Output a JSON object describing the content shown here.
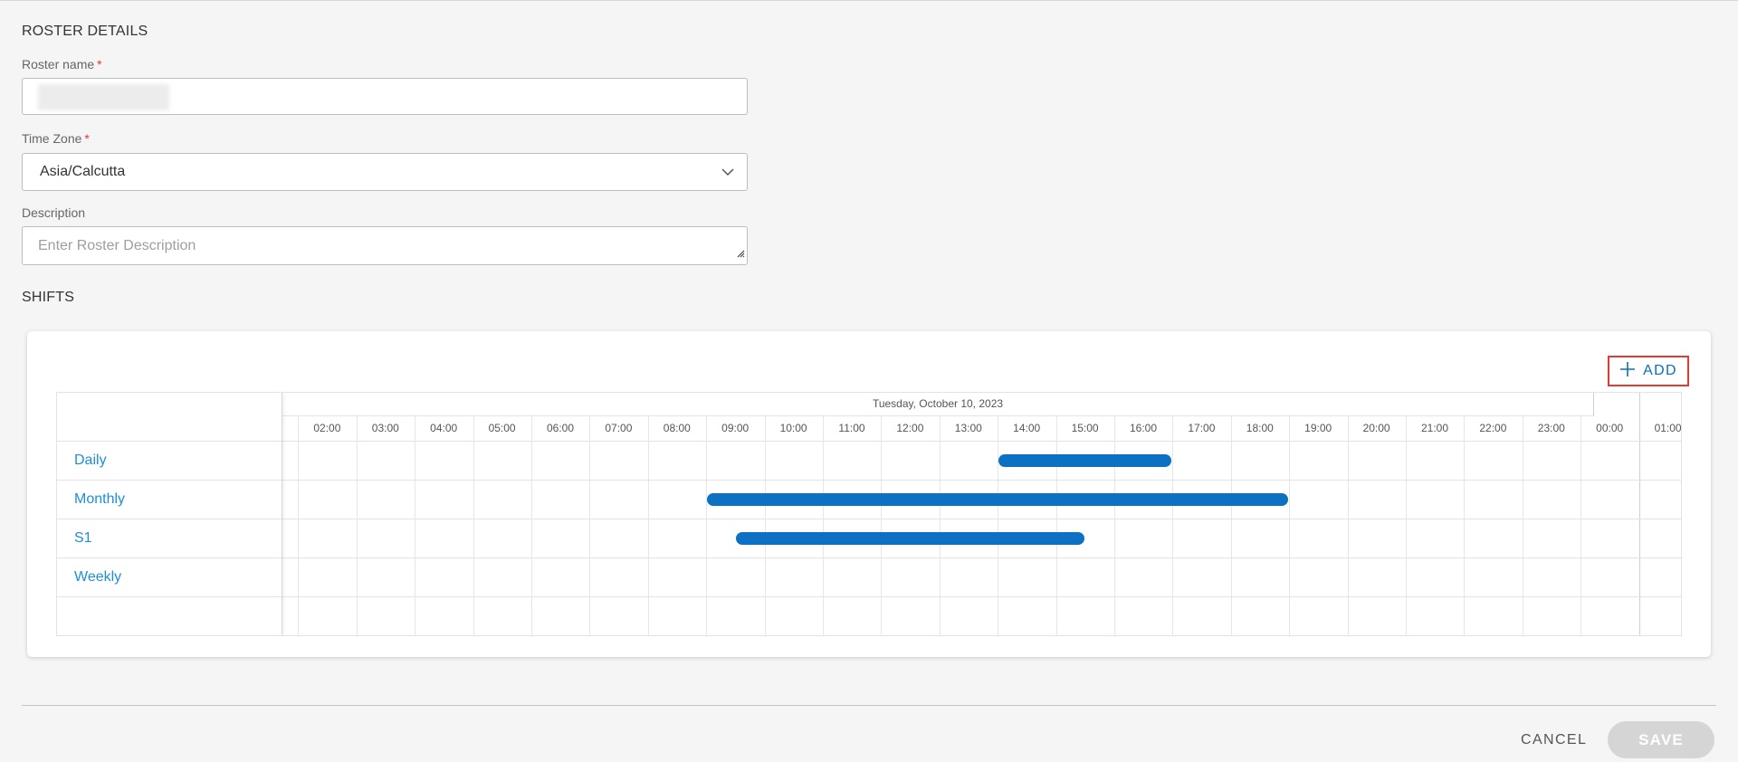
{
  "roster_details": {
    "title": "ROSTER DETAILS",
    "name_label": "Roster name",
    "required_mark": "*",
    "name_value": "",
    "timezone_label": "Time Zone",
    "timezone_value": "Asia/Calcutta",
    "description_label": "Description",
    "description_placeholder": "Enter Roster Description"
  },
  "shifts": {
    "title": "SHIFTS",
    "add_label": "ADD",
    "date_header": "Tuesday, October 10, 2023",
    "hours": [
      "02:00",
      "03:00",
      "04:00",
      "05:00",
      "06:00",
      "07:00",
      "08:00",
      "09:00",
      "10:00",
      "11:00",
      "12:00",
      "13:00",
      "14:00",
      "15:00",
      "16:00",
      "17:00",
      "18:00",
      "19:00",
      "20:00",
      "21:00",
      "22:00",
      "23:00",
      "00:00",
      "01:00"
    ],
    "rows": [
      {
        "label": "Daily"
      },
      {
        "label": "Monthly"
      },
      {
        "label": "S1"
      },
      {
        "label": "Weekly"
      }
    ],
    "bars": [
      {
        "row": 0,
        "start_hour": 14.0,
        "end_hour": 17.0
      },
      {
        "row": 1,
        "start_hour": 9.0,
        "end_hour": 19.0
      },
      {
        "row": 2,
        "start_hour": 9.5,
        "end_hour": 15.5
      }
    ]
  },
  "footer": {
    "cancel_label": "CANCEL",
    "save_label": "SAVE"
  },
  "colors": {
    "accent": "#0c71c3",
    "link": "#1e8fd6",
    "required": "#e53935",
    "disabled": "#d5d5d5"
  },
  "icons": {
    "add": "plus-icon",
    "dropdown": "chevron-down-icon",
    "resize": "resize-handle-icon"
  }
}
